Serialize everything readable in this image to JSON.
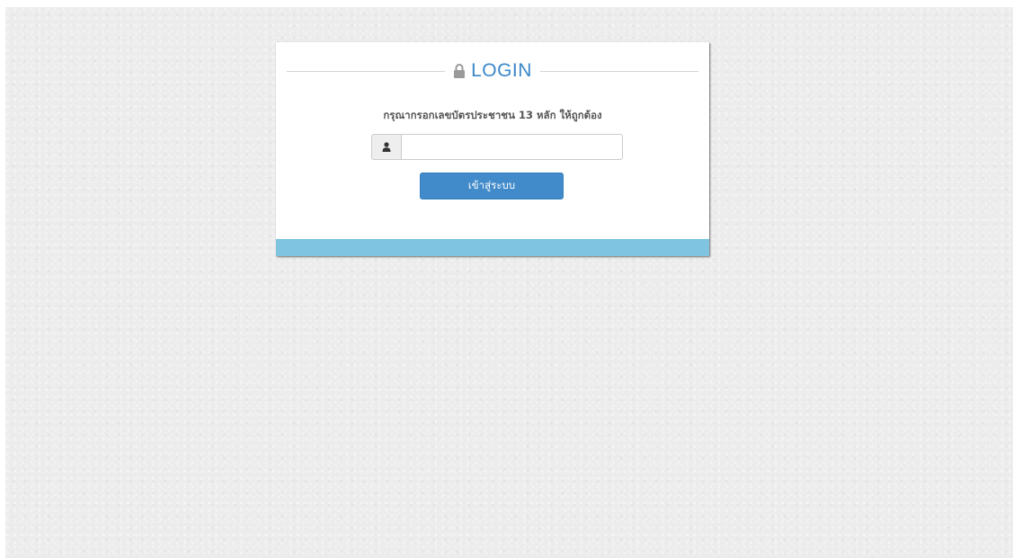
{
  "login": {
    "title": "LOGIN",
    "instruction": "กรุณากรอกเลขบัตรประชาชน 13 หลัก ให้ถูกต้อง",
    "id_input": {
      "value": "",
      "placeholder": ""
    },
    "submit_label": "เข้าสู่ระบบ",
    "icons": {
      "title_icon": "lock-icon",
      "input_icon": "user-icon"
    }
  },
  "colors": {
    "accent": "#428bca",
    "title": "#3a87c8",
    "footer_bar": "#7fc4e0",
    "background": "#ececec"
  }
}
